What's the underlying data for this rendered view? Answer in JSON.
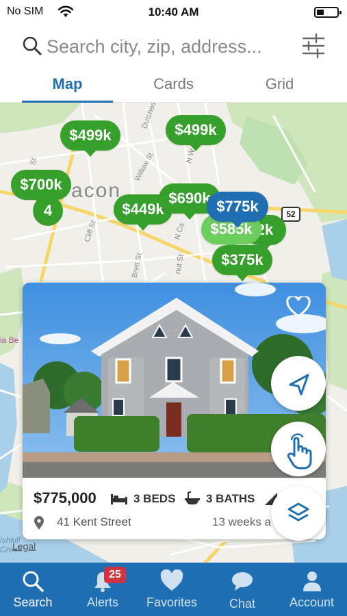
{
  "status_bar": {
    "carrier": "No SIM",
    "time": "10:40 AM"
  },
  "search": {
    "placeholder": "Search city, zip, address..."
  },
  "tabs": [
    {
      "label": "Map",
      "active": true
    },
    {
      "label": "Cards",
      "active": false
    },
    {
      "label": "Grid",
      "active": false
    }
  ],
  "map": {
    "city_label": "acon",
    "streets": [
      "Dutchess",
      "Willow St",
      "Cliff St",
      "Brett St",
      "N Ca",
      "nut St",
      "St",
      "N W"
    ],
    "route_badge": "52",
    "side_label": "ia Be",
    "creek_label": "ishkill\nCreek",
    "legal": "Legal",
    "price_pins": [
      {
        "label": "$499k",
        "state": "normal"
      },
      {
        "label": "$499k",
        "state": "normal"
      },
      {
        "label": "$700k",
        "state": "normal"
      },
      {
        "label": "$449k",
        "state": "normal"
      },
      {
        "label": "$690k",
        "state": "normal"
      },
      {
        "label": "$775k",
        "state": "selected"
      },
      {
        "label": "$585k",
        "state": "faded"
      },
      {
        "label": "2k",
        "state": "normal"
      },
      {
        "label": "$375k",
        "state": "normal"
      }
    ],
    "cluster_count": "4"
  },
  "listing": {
    "price": "$775,000",
    "beds": "3 BEDS",
    "baths": "3 BATHS",
    "sqft": "S",
    "address": "41 Kent Street",
    "listed_ago": "13 weeks a",
    "favorited": false
  },
  "bottom_nav": [
    {
      "label": "Search",
      "icon": "search-icon",
      "active": true
    },
    {
      "label": "Alerts",
      "icon": "bell-icon",
      "active": false,
      "badge": "25"
    },
    {
      "label": "Favorites",
      "icon": "heart-icon",
      "active": false
    },
    {
      "label": "Chat",
      "icon": "chat-icon",
      "active": false
    },
    {
      "label": "Account",
      "icon": "person-icon",
      "active": false
    }
  ],
  "colors": {
    "brand_blue": "#1f6fb2",
    "pin_green": "#37a02c",
    "badge_red": "#d0343f",
    "map_bg": "#f1efe9"
  }
}
